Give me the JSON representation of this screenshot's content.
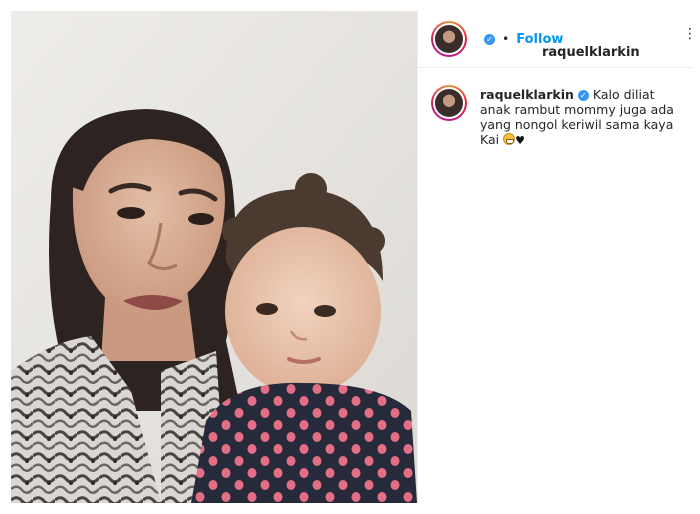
{
  "post": {
    "author": {
      "username": "raquelklarkin",
      "verified": true
    },
    "follow_label": "Follow",
    "separator": "•",
    "caption": {
      "username": "raquelklarkin",
      "text": "Kalo diliat anak rambut mommy juga ada yang nongol keriwil sama kaya Kai",
      "emojis": [
        "grinning-face-emoji",
        "black-heart-emoji"
      ],
      "heart": "♥"
    },
    "more_icon": "⋮",
    "verified_badge": "✓",
    "colors": {
      "follow": "#0095f6",
      "verified": "#3897f0",
      "border": "#efefef",
      "text": "#262626"
    }
  }
}
